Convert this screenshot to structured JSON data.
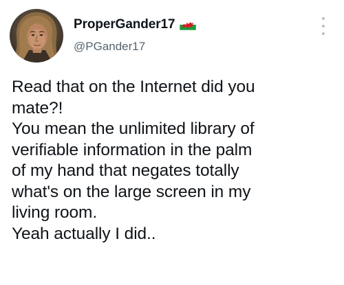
{
  "tweet": {
    "author": {
      "display_name": "ProperGander17",
      "handle": "@PGander17",
      "avatar_icon": "profile-photo",
      "flag_icon": "wales-flag-icon"
    },
    "more_icon": "more-options-icon",
    "text_lines": [
      "Read that on the Internet did you",
      "mate?!",
      "You mean the unlimited library of",
      "verifiable information in the palm",
      "of my hand that negates totally",
      "what's on the large screen in my",
      "living room.",
      "Yeah actually I did.."
    ]
  },
  "colors": {
    "text": "#0f1419",
    "secondary_text": "#536471",
    "background": "#ffffff"
  }
}
